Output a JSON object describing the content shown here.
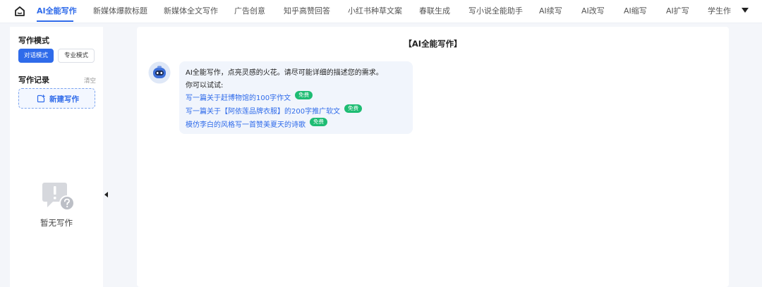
{
  "nav": {
    "tabs": [
      {
        "label": "AI全能写作",
        "active": true
      },
      {
        "label": "新媒体爆款标题"
      },
      {
        "label": "新媒体全文写作"
      },
      {
        "label": "广告创意"
      },
      {
        "label": "知乎高赞回答"
      },
      {
        "label": "小红书种草文案"
      },
      {
        "label": "春联生成"
      },
      {
        "label": "写小说全能助手"
      },
      {
        "label": "AI续写"
      },
      {
        "label": "AI改写"
      },
      {
        "label": "AI缩写"
      },
      {
        "label": "AI扩写"
      },
      {
        "label": "学生作"
      }
    ],
    "home_icon": "home-icon",
    "more_icon": "caret-down-icon"
  },
  "sidebar": {
    "mode_title": "写作模式",
    "mode_chat": "对话模式",
    "mode_pro": "专业模式",
    "record_title": "写作记录",
    "clear": "清空",
    "new_label": "新建写作",
    "empty_text": "暂无写作"
  },
  "main": {
    "title": "【AI全能写作】",
    "intro": "AI全能写作，点亮灵感的火花。请尽可能详细的描述您的需求。",
    "try_label": "你可以试试:",
    "suggestions": [
      {
        "text": "写一篇关于赶博物馆的100字作文",
        "badge": "免费"
      },
      {
        "text": "写一篇关于【阿依莲品牌衣服】的200字推广软文",
        "badge": "免费"
      },
      {
        "text": "模仿李白的风格写一首赞美夏天的诗歌",
        "badge": "免费"
      }
    ]
  },
  "colors": {
    "accent": "#2f6bea",
    "badge": "#1ebc73"
  }
}
